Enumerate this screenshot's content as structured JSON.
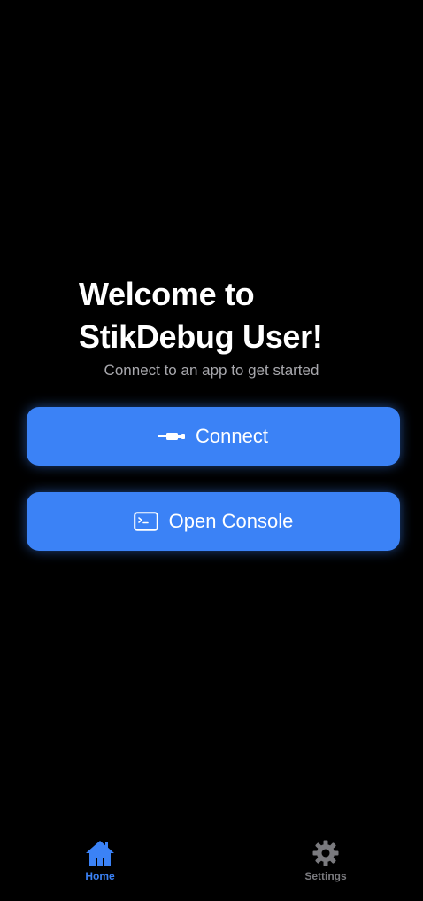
{
  "welcome": {
    "line1": "Welcome to",
    "line2": "StikDebug User!",
    "subtitle": "Connect to an app to get started"
  },
  "actions": {
    "connect_label": "Connect",
    "connect_icon": "cable-connector-icon",
    "console_label": "Open Console",
    "console_icon": "terminal-icon"
  },
  "tabbar": {
    "tabs": [
      {
        "label": "Home",
        "icon": "house-icon",
        "selected": true
      },
      {
        "label": "Settings",
        "icon": "gear-icon",
        "selected": false
      }
    ]
  },
  "colors": {
    "background": "#000000",
    "accent": "#3b82f6",
    "subtitle": "#a8a8ad",
    "inactive_tab": "#7a7a7e"
  }
}
